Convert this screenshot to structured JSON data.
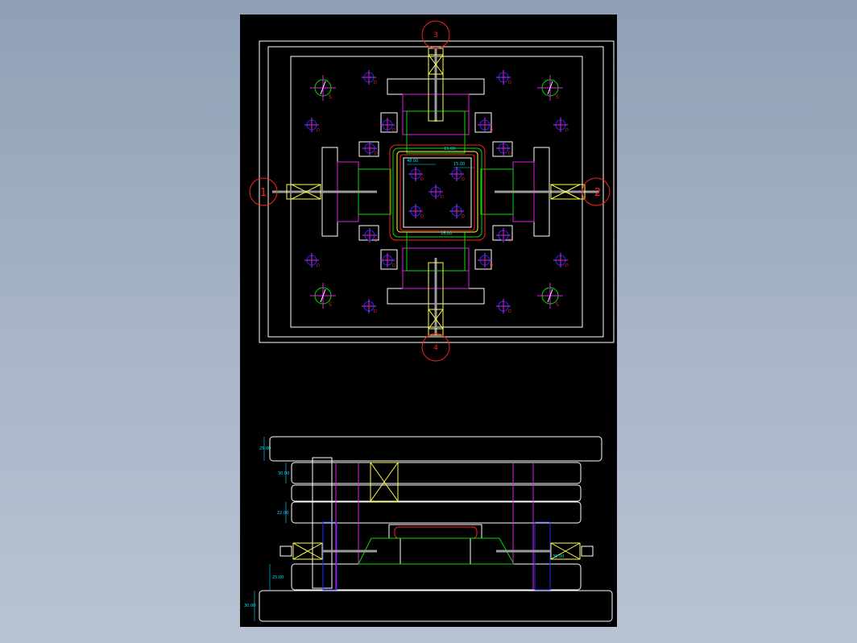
{
  "colors": {
    "background": "#000000",
    "white": "#ffffff",
    "red": "#ff2020",
    "green": "#00e000",
    "magenta": "#e020e0",
    "yellow": "#ffff40",
    "cyan": "#00e0ff",
    "blue": "#2030ff",
    "grey": "#9a9a9a"
  },
  "balloons": [
    "1",
    "2",
    "3",
    "4"
  ],
  "hole_marks": {
    "guide": "S",
    "dowel": "D",
    "center": "D"
  },
  "plan_dims": [
    "15.00",
    "48.00",
    "15.00",
    "16.00"
  ],
  "side_dims": [
    "25.00",
    "30.00",
    "22.00",
    "25.00",
    "30.00",
    "30.00"
  ]
}
